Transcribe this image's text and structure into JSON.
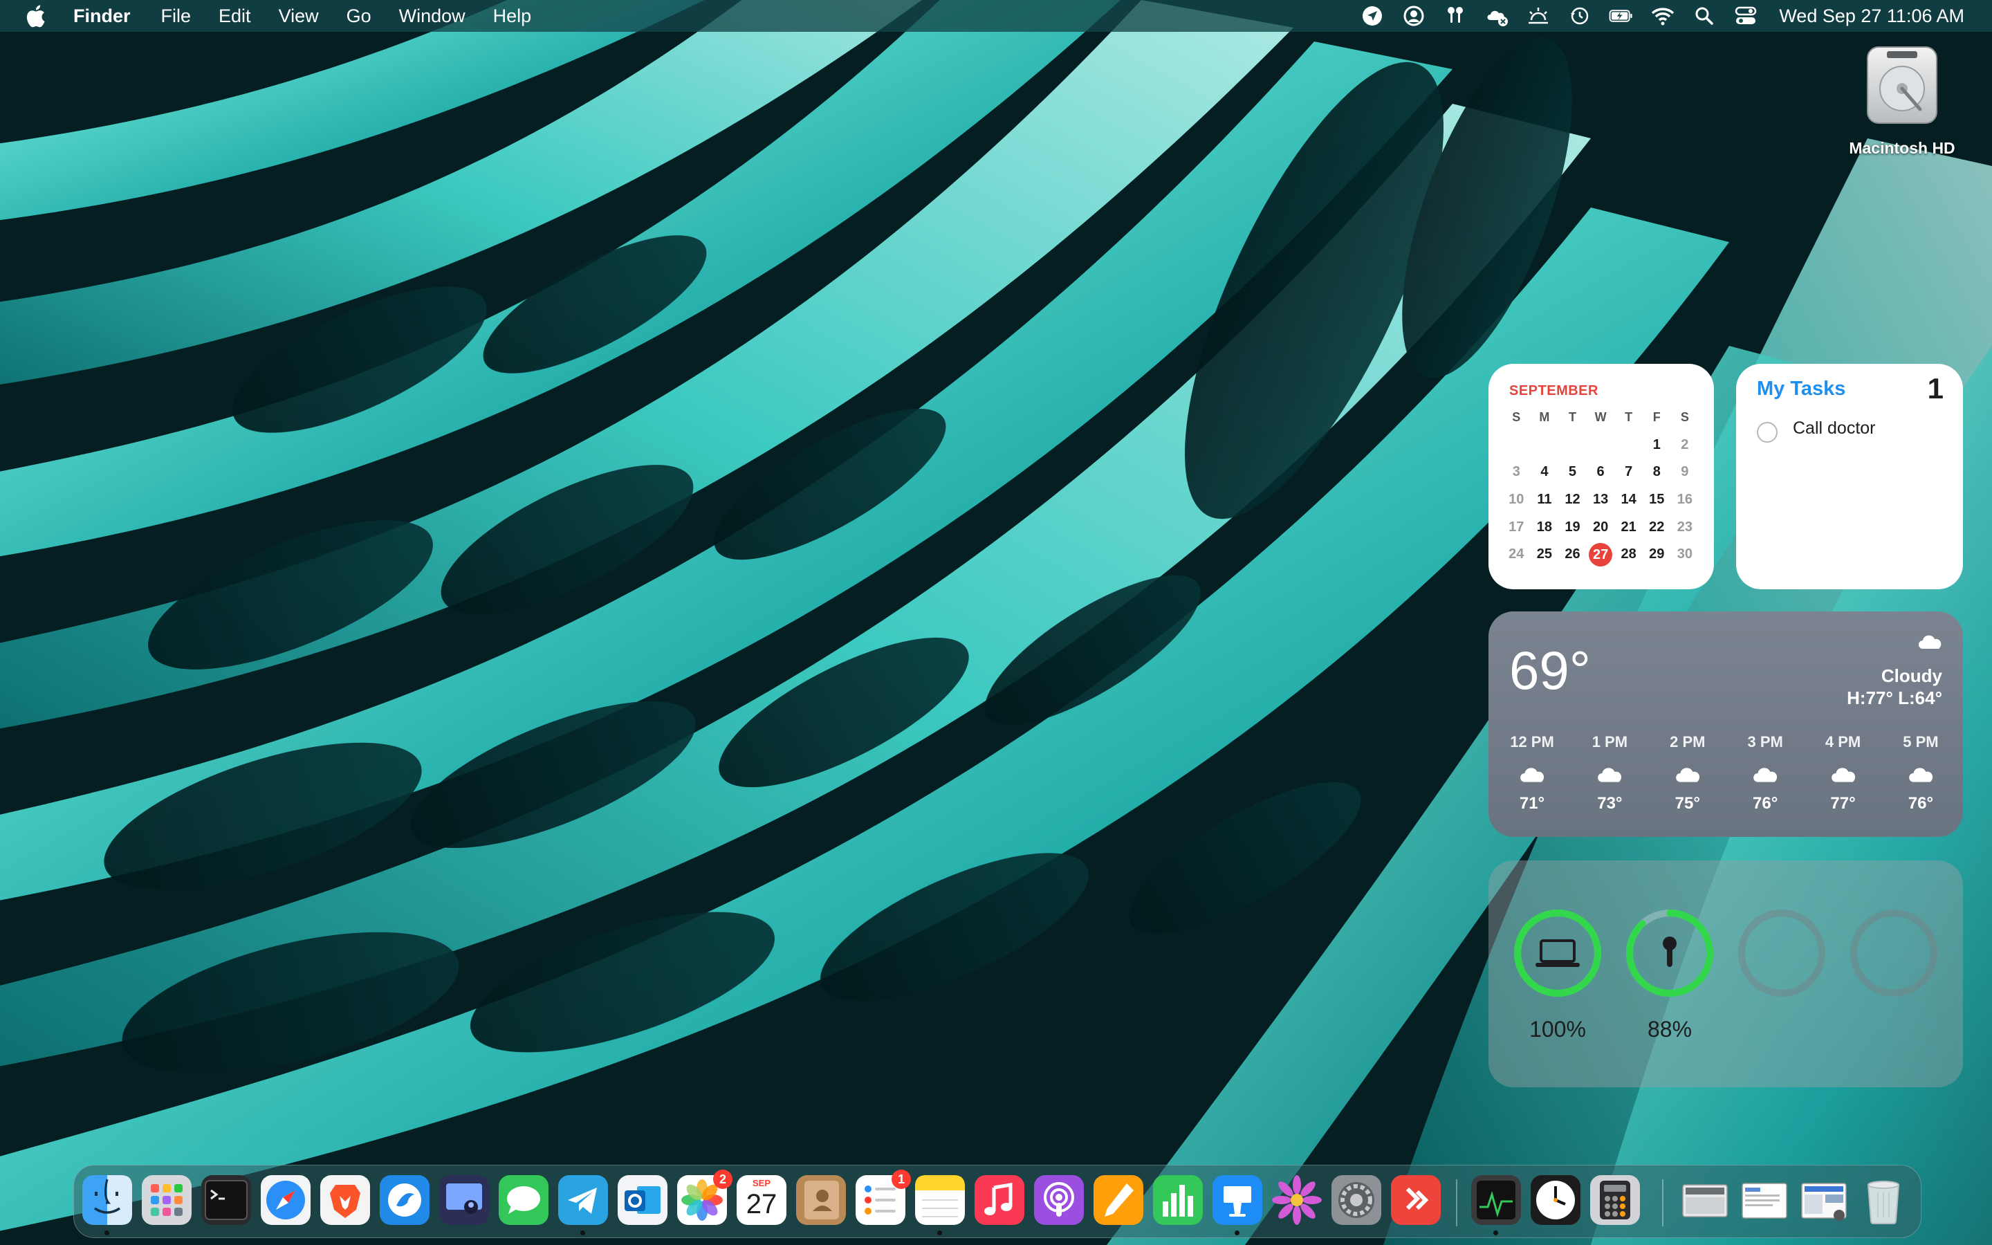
{
  "menubar": {
    "app_name": "Finder",
    "menus": [
      "File",
      "Edit",
      "View",
      "Go",
      "Window",
      "Help"
    ],
    "clock": "Wed Sep 27  11:06 AM",
    "status_icons": [
      "location-arrow-icon",
      "user-circle-icon",
      "airpods-icon",
      "icloud-cloud-icon",
      "brightness-icon",
      "time-machine-icon",
      "battery-charging-icon",
      "wifi-icon",
      "search-icon",
      "control-center-icon"
    ]
  },
  "desktop": {
    "drive_label": "Macintosh HD"
  },
  "calendar": {
    "month": "SEPTEMBER",
    "weekdays": [
      "S",
      "M",
      "T",
      "W",
      "T",
      "F",
      "S"
    ],
    "weeks": [
      [
        "",
        "",
        "",
        "",
        "",
        "1",
        "2"
      ],
      [
        "3",
        "4",
        "5",
        "6",
        "7",
        "8",
        "9"
      ],
      [
        "10",
        "11",
        "12",
        "13",
        "14",
        "15",
        "16"
      ],
      [
        "17",
        "18",
        "19",
        "20",
        "21",
        "22",
        "23"
      ],
      [
        "24",
        "25",
        "26",
        "27",
        "28",
        "29",
        "30"
      ]
    ],
    "today": "27"
  },
  "tasks": {
    "title": "My Tasks",
    "count": "1",
    "items": [
      "Call doctor"
    ]
  },
  "weather": {
    "temperature": "69°",
    "condition": "Cloudy",
    "high_low": "H:77° L:64°",
    "hourly": [
      {
        "time": "12 PM",
        "temp": "71°"
      },
      {
        "time": "1 PM",
        "temp": "73°"
      },
      {
        "time": "2 PM",
        "temp": "75°"
      },
      {
        "time": "3 PM",
        "temp": "76°"
      },
      {
        "time": "4 PM",
        "temp": "77°"
      },
      {
        "time": "5 PM",
        "temp": "76°"
      }
    ]
  },
  "batteries": {
    "mac_percent": "100%",
    "mac_level": 1.0,
    "airpods_percent": "88%",
    "airpods_level": 0.88,
    "ring_color": "#32d74b"
  },
  "dock": {
    "photos_badge": "2",
    "calendar_month": "SEP",
    "calendar_day": "27",
    "reminders_badge": "1"
  }
}
